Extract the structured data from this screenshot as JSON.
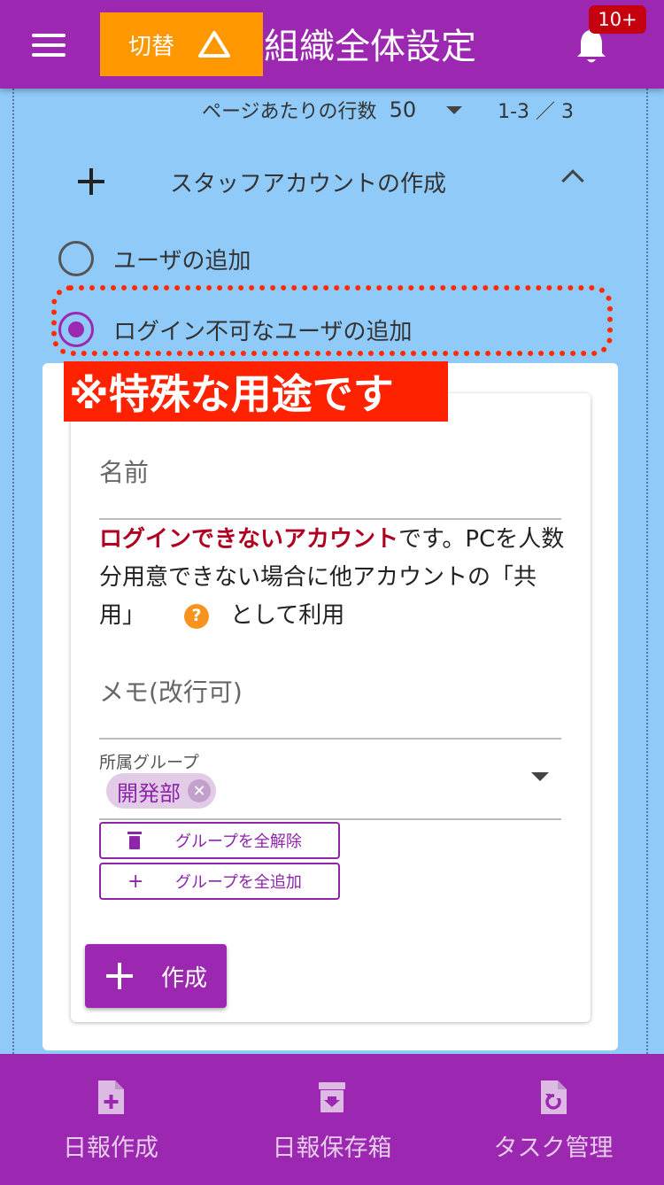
{
  "header": {
    "switch_label": "切替",
    "title": "組織全体設定",
    "badge": "10+"
  },
  "pagination": {
    "rows_label": "ページあたりの行数",
    "rows_value": "50",
    "range": "1-3 ／ 3"
  },
  "section": {
    "title": "スタッフアカウントの作成"
  },
  "radios": [
    {
      "label": "ユーザの追加",
      "checked": false
    },
    {
      "label": "ログイン不可なユーザの追加",
      "checked": true
    }
  ],
  "annotation": "※特殊な用途です",
  "form": {
    "name_placeholder": "名前",
    "desc_emphasis": "ログインできないアカウント",
    "desc_part1": "です。PCを人数分用意できない場合に他アカウントの「共用」",
    "desc_part2": "として利用",
    "memo_placeholder": "メモ(改行可)",
    "group_label": "所属グループ",
    "group_chip": "開発部",
    "clear_groups": "グループを全解除",
    "add_groups": "グループを全追加",
    "create": "作成"
  },
  "bottom_nav": [
    {
      "label": "日報作成",
      "icon": "file-plus-icon"
    },
    {
      "label": "日報保存箱",
      "icon": "archive-icon"
    },
    {
      "label": "タスク管理",
      "icon": "file-refresh-icon"
    }
  ],
  "colors": {
    "primary": "#9c27b0",
    "accent": "#ff9800",
    "background": "#90caf9",
    "annotation": "#ff2200"
  }
}
